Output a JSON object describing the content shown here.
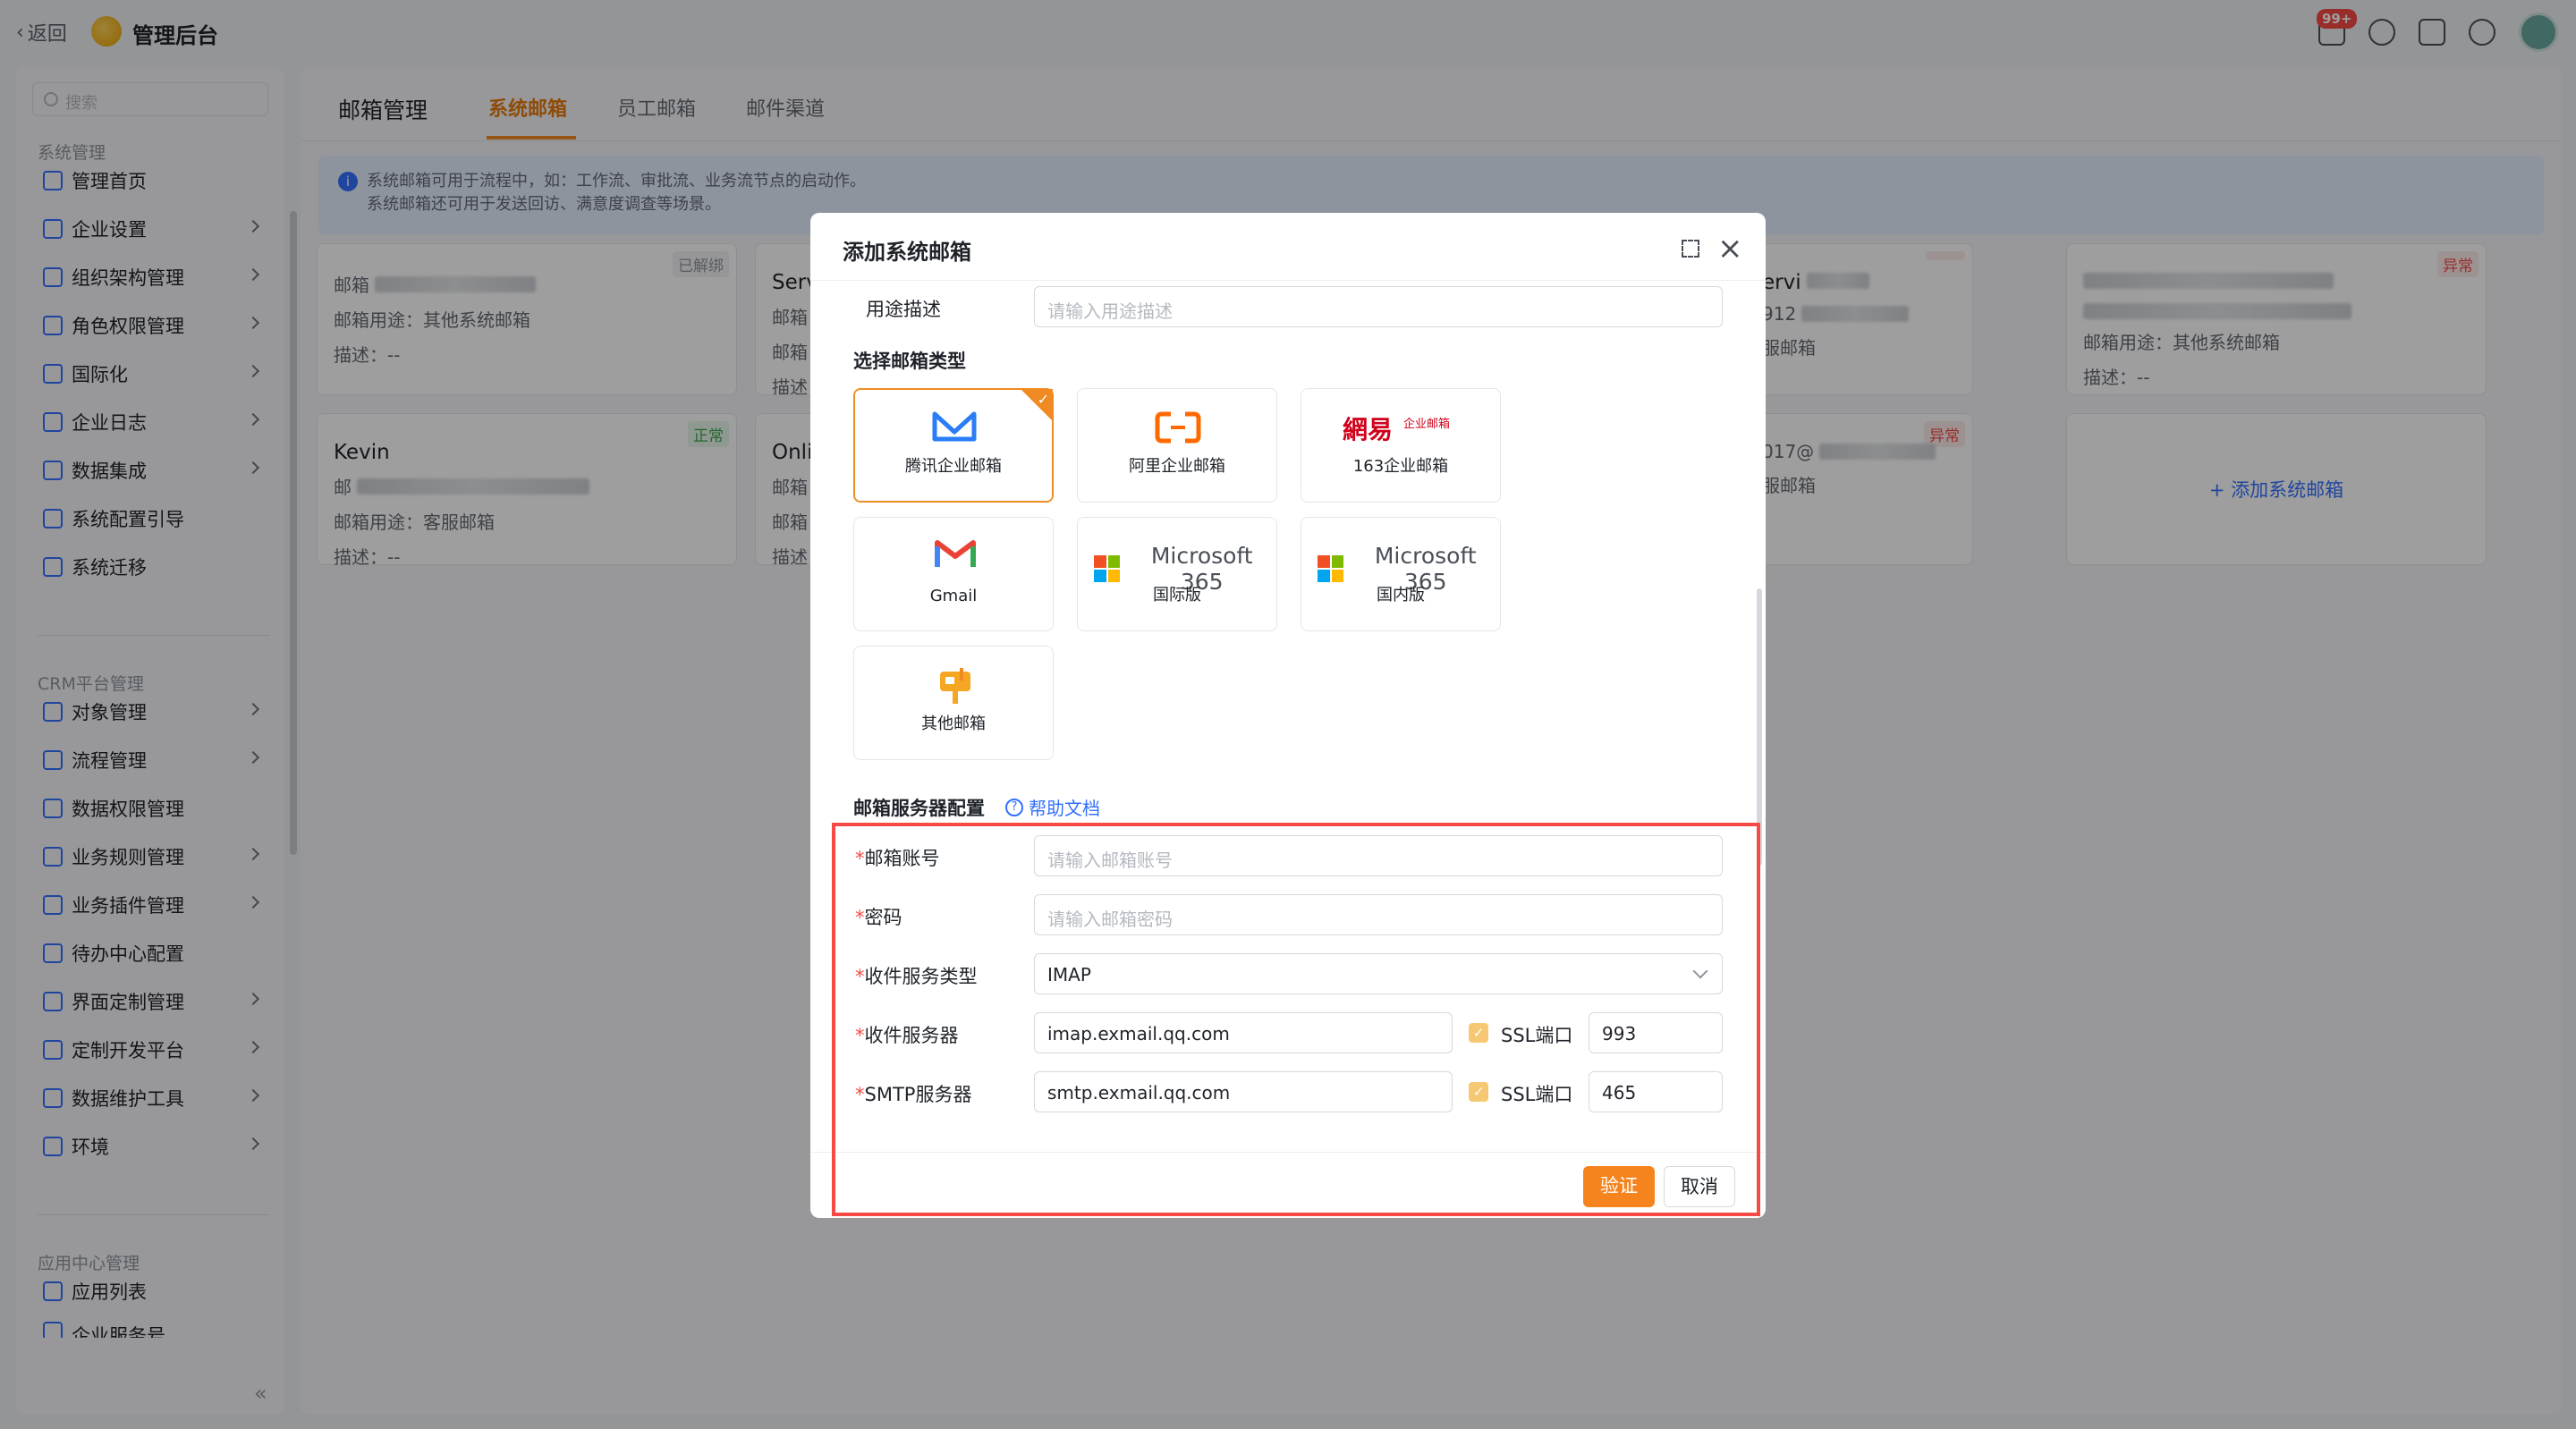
{
  "topbar": {
    "back_label": "返回",
    "app_title": "管理后台",
    "badge": "99+"
  },
  "sidebar": {
    "search_placeholder": "搜索",
    "groups": [
      {
        "title": "系统管理",
        "items": [
          "管理首页",
          "企业设置",
          "组织架构管理",
          "角色权限管理",
          "国际化",
          "企业日志",
          "数据集成",
          "系统配置引导",
          "系统迁移"
        ]
      },
      {
        "title": "CRM平台管理",
        "items": [
          "对象管理",
          "流程管理",
          "数据权限管理",
          "业务规则管理",
          "业务插件管理",
          "待办中心配置",
          "界面定制管理",
          "定制开发平台",
          "数据维护工具",
          "环境"
        ]
      },
      {
        "title": "应用中心管理",
        "items": [
          "应用列表",
          "企业服务号"
        ]
      }
    ],
    "collapse": "«"
  },
  "main": {
    "tabs": [
      "邮箱管理",
      "系统邮箱",
      "员工邮箱",
      "邮件渠道"
    ],
    "info_line1": "系统邮箱可用于流程中，如：工作流、审批流、业务流节点的启动作。",
    "info_line2": "系统邮箱还可用于发送回访、满意度调查等场景。",
    "cards": [
      {
        "tag": "已解绑",
        "name": "",
        "l1": "邮箱",
        "l2": "邮箱用途：其他系统邮箱",
        "l3": "描述：--"
      },
      {
        "tag": "",
        "name": "Serv",
        "l1": "邮箱",
        "l2": "邮箱",
        "l3": "描述"
      },
      {
        "tag": "",
        "name": "ervi",
        "l1": "912",
        "l2": "服邮箱",
        "l3": ""
      },
      {
        "tag": "异常",
        "name": "",
        "l1": "",
        "l2": "邮箱用途：其他系统邮箱",
        "l3": "描述：--"
      },
      {
        "tag": "正常",
        "name": "Kevin",
        "l1": "邮",
        "l2": "邮箱用途：客服邮箱",
        "l3": "描述：--"
      },
      {
        "tag": "",
        "name": "Onli",
        "l1": "邮箱",
        "l2": "邮箱",
        "l3": "描述"
      },
      {
        "tag": "异常",
        "name": "",
        "l1": "017@",
        "l2": "服邮箱",
        "l3": ""
      }
    ],
    "add_card": "+ 添加系统邮箱"
  },
  "modal": {
    "title": "添加系统邮箱",
    "desc_label": "用途描述",
    "desc_placeholder": "请输入用途描述",
    "type_section": "选择邮箱类型",
    "types": [
      {
        "label": "腾讯企业邮箱",
        "selected": true
      },
      {
        "label": "阿里企业邮箱"
      },
      {
        "label": "163企业邮箱",
        "logo": "網易",
        "logo_sub": "企业邮箱"
      },
      {
        "label": "Gmail"
      },
      {
        "label": "国际版",
        "logo": "Microsoft 365"
      },
      {
        "label": "国内版",
        "logo": "Microsoft 365"
      },
      {
        "label": "其他邮箱"
      }
    ],
    "server_section": "邮箱服务器配置",
    "help_label": "帮助文档",
    "req_mark": "*",
    "fields": {
      "account_label": "邮箱账号",
      "account_placeholder": "请输入邮箱账号",
      "password_label": "密码",
      "password_placeholder": "请输入邮箱密码",
      "protocol_label": "收件服务类型",
      "protocol_value": "IMAP",
      "incoming_label": "收件服务器",
      "incoming_value": "imap.exmail.qq.com",
      "smtp_label": "SMTP服务器",
      "smtp_value": "smtp.exmail.qq.com",
      "ssl_label": "SSL端口",
      "incoming_port": "993",
      "smtp_port": "465"
    },
    "verify_label": "验证",
    "cancel_label": "取消"
  },
  "colors": {
    "accent": "#f5841f",
    "link": "#3370ff",
    "danger": "#f54a45"
  }
}
